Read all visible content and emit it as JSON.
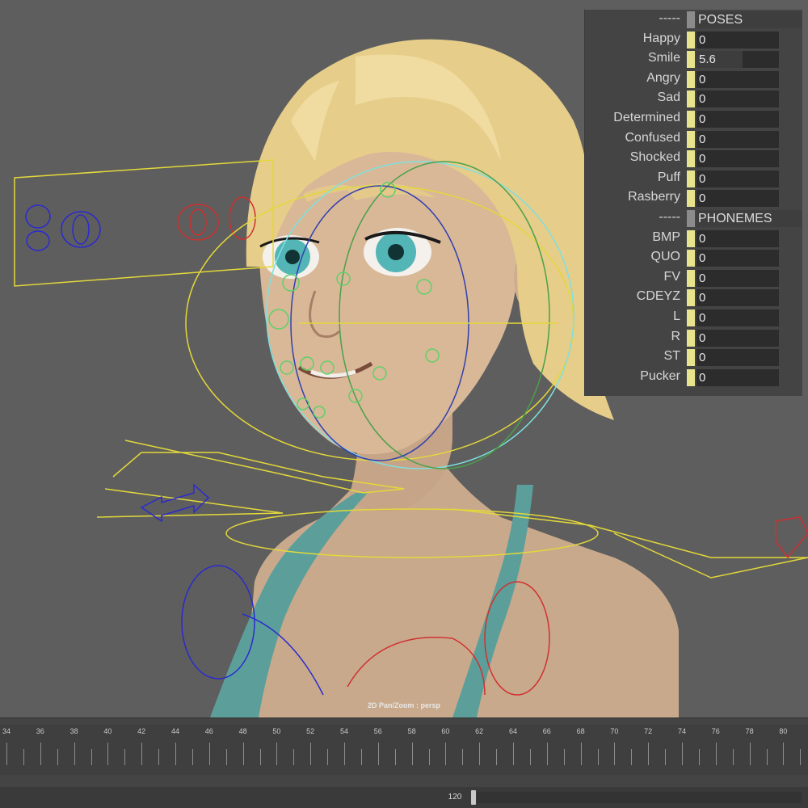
{
  "viewport": {
    "label": "2D Pan/Zoom : persp"
  },
  "channel_box": {
    "sections": [
      {
        "prefix": "-----",
        "title": "POSES",
        "attributes": [
          {
            "label": "Happy",
            "value": "0",
            "fraction": 0
          },
          {
            "label": "Smile",
            "value": "5.6",
            "fraction": 0.56
          },
          {
            "label": "Angry",
            "value": "0",
            "fraction": 0
          },
          {
            "label": "Sad",
            "value": "0",
            "fraction": 0
          },
          {
            "label": "Determined",
            "value": "0",
            "fraction": 0
          },
          {
            "label": "Confused",
            "value": "0",
            "fraction": 0
          },
          {
            "label": "Shocked",
            "value": "0",
            "fraction": 0
          },
          {
            "label": "Puff",
            "value": "0",
            "fraction": 0
          },
          {
            "label": "Rasberry",
            "value": "0",
            "fraction": 0
          }
        ]
      },
      {
        "prefix": "-----",
        "title": "PHONEMES",
        "attributes": [
          {
            "label": "BMP",
            "value": "0",
            "fraction": 0
          },
          {
            "label": "QUO",
            "value": "0",
            "fraction": 0
          },
          {
            "label": "FV",
            "value": "0",
            "fraction": 0
          },
          {
            "label": "CDEYZ",
            "value": "0",
            "fraction": 0
          },
          {
            "label": "L",
            "value": "0",
            "fraction": 0
          },
          {
            "label": "R",
            "value": "0",
            "fraction": 0
          },
          {
            "label": "ST",
            "value": "0",
            "fraction": 0
          },
          {
            "label": "Pucker",
            "value": "0",
            "fraction": 0
          }
        ]
      }
    ],
    "colors": {
      "keyable_swatch": "#e8e48e",
      "header_swatch": "#8b8b8b"
    }
  },
  "timeline": {
    "frame_labels": [
      "34",
      "36",
      "38",
      "40",
      "42",
      "44",
      "46",
      "48",
      "50",
      "52",
      "54",
      "56",
      "58",
      "60",
      "62",
      "64",
      "66",
      "68",
      "70",
      "72",
      "74",
      "76",
      "78",
      "80"
    ]
  },
  "range_slider": {
    "end_value": "120"
  }
}
